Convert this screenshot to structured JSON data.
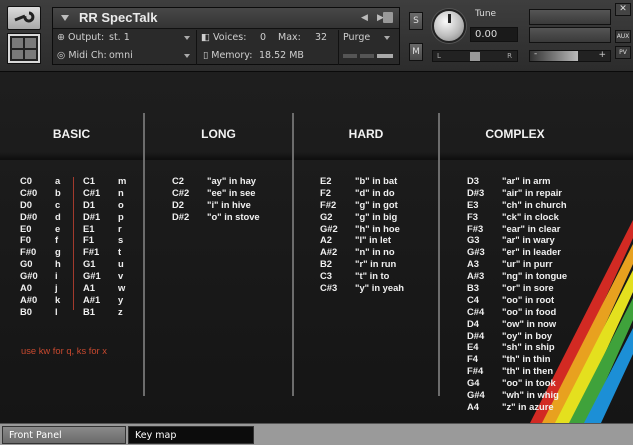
{
  "header": {
    "instrument_name": "RR SpecTalk",
    "output_label": "Output:",
    "output_value": "st. 1",
    "voices_label": "Voices:",
    "voices_value": "0",
    "max_label": "Max:",
    "max_value": "32",
    "purge_label": "Purge",
    "midi_label": "Midi Ch:",
    "midi_value": "omni",
    "memory_label": "Memory:",
    "memory_value": "18.52 MB",
    "solo_label": "S",
    "mute_label": "M",
    "tune_label": "Tune",
    "tune_value": "0.00",
    "pan_left": "L",
    "pan_right": "R",
    "aux_label": "AUX",
    "pv_label": "PV",
    "nav_prev": "◀",
    "nav_next": "▶",
    "vol_minus": "-",
    "vol_plus": "+"
  },
  "columns": {
    "basic": "BASIC",
    "long": "LONG",
    "hard": "HARD",
    "complex": "COMPLEX"
  },
  "basic": [
    [
      "C0",
      "a",
      "C1",
      "m"
    ],
    [
      "C#0",
      "b",
      "C#1",
      "n"
    ],
    [
      "D0",
      "c",
      "D1",
      "o"
    ],
    [
      "D#0",
      "d",
      "D#1",
      "p"
    ],
    [
      "E0",
      "e",
      "E1",
      "r"
    ],
    [
      "F0",
      "f",
      "F1",
      "s"
    ],
    [
      "F#0",
      "g",
      "F#1",
      "t"
    ],
    [
      "G0",
      "h",
      "G1",
      "u"
    ],
    [
      "G#0",
      "i",
      "G#1",
      "v"
    ],
    [
      "A0",
      "j",
      "A1",
      "w"
    ],
    [
      "A#0",
      "k",
      "A#1",
      "y"
    ],
    [
      "B0",
      "l",
      "B1",
      "z"
    ]
  ],
  "basic_note": "use kw for q, ks for x",
  "long": [
    [
      "C2",
      "\"ay\" in hay"
    ],
    [
      "C#2",
      "\"ee\" in see"
    ],
    [
      "D2",
      "\"i\" in hive"
    ],
    [
      "D#2",
      "\"o\" in stove"
    ]
  ],
  "hard": [
    [
      "E2",
      "\"b\" in bat"
    ],
    [
      "F2",
      "\"d\" in do"
    ],
    [
      "F#2",
      "\"g\" in got"
    ],
    [
      "G2",
      "\"g\" in big"
    ],
    [
      "G#2",
      "\"h\" in hoe"
    ],
    [
      "A2",
      "\"l\" in let"
    ],
    [
      "A#2",
      "\"n\" in no"
    ],
    [
      "B2",
      "\"r\" in run"
    ],
    [
      "C3",
      "\"t\" in to"
    ],
    [
      "C#3",
      "\"y\" in yeah"
    ]
  ],
  "complex": [
    [
      "D3",
      "\"ar\" in arm"
    ],
    [
      "D#3",
      "\"air\" in repair"
    ],
    [
      "E3",
      "\"ch\" in church"
    ],
    [
      "F3",
      "\"ck\" in clock"
    ],
    [
      "F#3",
      "\"ear\" in clear"
    ],
    [
      "G3",
      "\"ar\" in wary"
    ],
    [
      "G#3",
      "\"er\" in leader"
    ],
    [
      "A3",
      "\"ur\" in purr"
    ],
    [
      "A#3",
      "\"ng\" in tongue"
    ],
    [
      "B3",
      "\"or\" in sore"
    ],
    [
      "C4",
      "\"oo\" in root"
    ],
    [
      "C#4",
      "\"oo\" in food"
    ],
    [
      "D4",
      "\"ow\" in now"
    ],
    [
      "D#4",
      "\"oy\" in boy"
    ],
    [
      "E4",
      "\"sh\" in ship"
    ],
    [
      "F4",
      "\"th\" in thin"
    ],
    [
      "F#4",
      "\"th\" in then"
    ],
    [
      "G4",
      "\"oo\" in took"
    ],
    [
      "G#4",
      "\"wh\" in whig"
    ],
    [
      "A4",
      "\"z\" in azure"
    ]
  ],
  "tabs": {
    "front_panel": "Front Panel",
    "key_map": "Key map"
  },
  "colors": {
    "rainbow": [
      "#d22a23",
      "#e8a11f",
      "#e4e01e",
      "#3fa23b",
      "#1c8fd6"
    ],
    "note_text": "#c8492f",
    "divider": "#6c6c6c"
  }
}
